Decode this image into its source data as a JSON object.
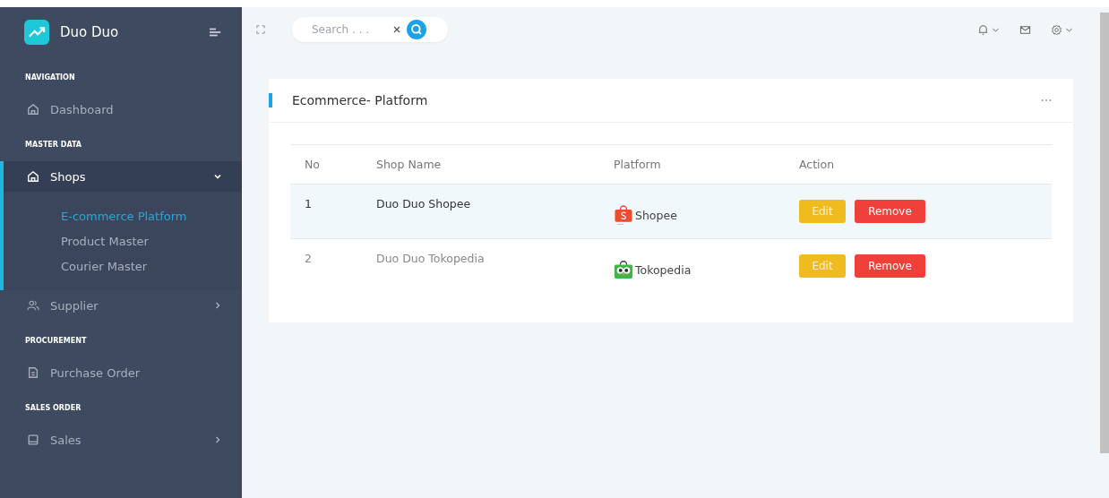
{
  "brand": {
    "name": "Duo Duo"
  },
  "sidebar": {
    "items": [
      {
        "kind": "header",
        "label": "NAVIGATION"
      },
      {
        "kind": "link",
        "label": "Dashboard",
        "selected": false
      },
      {
        "kind": "header",
        "label": "MASTER DATA"
      },
      {
        "kind": "group",
        "label": "Shops",
        "expanded": true,
        "children": [
          {
            "label": "E-commerce Platform",
            "selected": true
          },
          {
            "label": "Product Master",
            "selected": false
          },
          {
            "label": "Courier Master",
            "selected": false
          }
        ]
      },
      {
        "kind": "group",
        "label": "Supplier",
        "expanded": false
      },
      {
        "kind": "header",
        "label": "PROCUREMENT"
      },
      {
        "kind": "link",
        "label": "Purchase Order",
        "selected": false
      },
      {
        "kind": "header",
        "label": "SALES ORDER"
      },
      {
        "kind": "group",
        "label": "Sales",
        "expanded": false
      }
    ]
  },
  "search": {
    "placeholder": "Search . . ."
  },
  "card": {
    "title": "Ecommerce- Platform",
    "table": {
      "columns": [
        "No",
        "Shop Name",
        "Platform",
        "Action"
      ],
      "rows": [
        {
          "no": "1",
          "shop_name": "Duo Duo Shopee",
          "platform": {
            "kind": "shopee",
            "label": "Shopee"
          },
          "actions": [
            "Edit",
            "Remove"
          ],
          "selected": true
        },
        {
          "no": "2",
          "shop_name": "Duo Duo Tokopedia",
          "platform": {
            "kind": "tokopedia",
            "label": "Tokopedia"
          },
          "actions": [
            "Edit",
            "Remove"
          ],
          "selected": false
        }
      ]
    }
  }
}
